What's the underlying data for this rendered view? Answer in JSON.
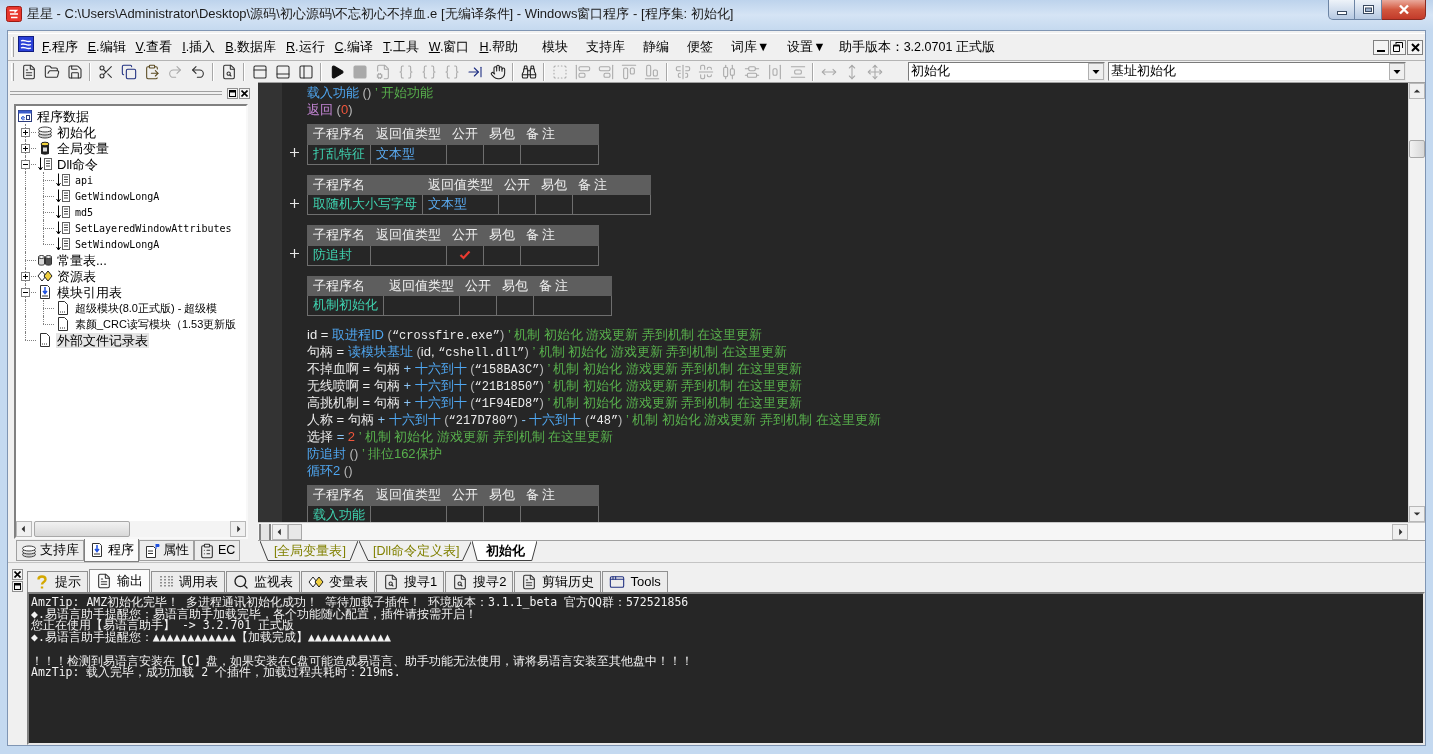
{
  "window": {
    "title": "星星 - C:\\Users\\Administrator\\Desktop\\源码\\初心源码\\不忘初心不掉血.e [无编译条件] - Windows窗口程序 - [程序集: 初始化]"
  },
  "menu": {
    "main": [
      {
        "hotkey": "F",
        "label": ".程序"
      },
      {
        "hotkey": "E",
        "label": ".编辑"
      },
      {
        "hotkey": "V",
        "label": ".查看"
      },
      {
        "hotkey": "I",
        "label": ".插入"
      },
      {
        "hotkey": "B",
        "label": ".数据库"
      },
      {
        "hotkey": "R",
        "label": ".运行"
      },
      {
        "hotkey": "C",
        "label": ".编译"
      },
      {
        "hotkey": "T",
        "label": ".工具"
      },
      {
        "hotkey": "W",
        "label": ".窗口"
      },
      {
        "hotkey": "H",
        "label": ".帮助"
      }
    ],
    "plugins": [
      {
        "label": "模块"
      },
      {
        "label": "支持库"
      },
      {
        "label": "静编"
      },
      {
        "label": "便签"
      },
      {
        "label": "词库▼"
      },
      {
        "label": "设置▼"
      }
    ],
    "version": "助手版本：3.2.0701 正式版"
  },
  "toolbar": {
    "groups": [
      [
        {
          "kind": "new",
          "disabled": false
        },
        {
          "kind": "open",
          "disabled": false
        },
        {
          "kind": "save",
          "disabled": false
        }
      ],
      [
        {
          "kind": "cut",
          "disabled": false
        },
        {
          "kind": "copy",
          "disabled": false
        },
        {
          "kind": "paste",
          "disabled": false
        },
        {
          "kind": "redo",
          "disabled": true
        },
        {
          "kind": "undo",
          "disabled": false
        }
      ],
      [
        {
          "kind": "preview",
          "disabled": false
        }
      ],
      [
        {
          "kind": "paneltop",
          "disabled": false
        },
        {
          "kind": "panelbottom",
          "disabled": false
        },
        {
          "kind": "panelleft",
          "disabled": false
        }
      ],
      [
        {
          "kind": "run",
          "disabled": false
        },
        {
          "kind": "stop",
          "disabled": true
        },
        {
          "kind": "debug",
          "disabled": true
        },
        {
          "kind": "stepinto",
          "disabled": true
        },
        {
          "kind": "stepover",
          "disabled": true
        },
        {
          "kind": "stepout",
          "disabled": true
        },
        {
          "kind": "runto",
          "disabled": false
        },
        {
          "kind": "hand",
          "disabled": false
        }
      ],
      [
        {
          "kind": "find",
          "disabled": false
        }
      ],
      [
        {
          "kind": "form",
          "disabled": true
        },
        {
          "kind": "alignleft",
          "disabled": true
        },
        {
          "kind": "alignright",
          "disabled": true
        },
        {
          "kind": "aligntop",
          "disabled": true
        },
        {
          "kind": "alignbottom",
          "disabled": true
        }
      ],
      [
        {
          "kind": "centerh",
          "disabled": true
        },
        {
          "kind": "centerv",
          "disabled": true
        },
        {
          "kind": "distributeh",
          "disabled": true
        },
        {
          "kind": "distributev",
          "disabled": true
        },
        {
          "kind": "spaceh",
          "disabled": true
        },
        {
          "kind": "spacev",
          "disabled": true
        }
      ],
      [
        {
          "kind": "samewidth",
          "disabled": true
        },
        {
          "kind": "sameheight",
          "disabled": true
        },
        {
          "kind": "samesize",
          "disabled": true
        }
      ]
    ],
    "selectors": [
      {
        "value": "初始化"
      },
      {
        "value": "基址初始化"
      }
    ]
  },
  "sidebar": {
    "tree": {
      "label": "程序数据",
      "kind": "root",
      "selected": false,
      "children": [
        {
          "label": "初始化",
          "kind": "module",
          "expanded": false,
          "selected": false
        },
        {
          "label": "全局变量",
          "kind": "variables",
          "expanded": false,
          "selected": false
        },
        {
          "label": "Dll命令",
          "kind": "dll",
          "expanded": true,
          "selected": false,
          "children": [
            {
              "label": "api",
              "kind": "dll",
              "selected": false
            },
            {
              "label": "GetWindowLongA",
              "kind": "dll",
              "selected": false
            },
            {
              "label": "md5",
              "kind": "dll",
              "selected": false
            },
            {
              "label": "SetLayeredWindowAttributes",
              "kind": "dll",
              "selected": false
            },
            {
              "label": "SetWindowLongA",
              "kind": "dll",
              "selected": false
            }
          ]
        },
        {
          "label": "常量表...",
          "kind": "constants",
          "selected": false
        },
        {
          "label": "资源表",
          "kind": "resources",
          "expanded": false,
          "selected": false
        },
        {
          "label": "模块引用表",
          "kind": "modules",
          "expanded": true,
          "selected": false,
          "children": [
            {
              "label": "超级模块(8.0正式版) - 超级模",
              "kind": "file",
              "selected": false
            },
            {
              "label": "素颜_CRC读写模块（1.53更新版",
              "kind": "file",
              "selected": false
            }
          ]
        },
        {
          "label": "外部文件记录表",
          "kind": "file",
          "selected": true
        }
      ]
    },
    "tabs": [
      {
        "label": "支持库",
        "kind": "library",
        "selected": false
      },
      {
        "label": "程序",
        "kind": "program",
        "selected": true
      },
      {
        "label": "属性",
        "kind": "properties",
        "selected": false
      },
      {
        "label": "EC",
        "kind": "ec",
        "selected": false
      }
    ]
  },
  "editor": {
    "blocks": [
      {
        "kind": "line",
        "tokens": [
          {
            "kind": "call",
            "text": "载入功能"
          },
          {
            "kind": "punct",
            "text": " () "
          },
          {
            "kind": "comment",
            "text": "’ 开始功能"
          }
        ]
      },
      {
        "kind": "line",
        "tokens": [
          {
            "kind": "keyword",
            "text": "返回"
          },
          {
            "kind": "punct",
            "text": " ("
          },
          {
            "kind": "number",
            "text": "0"
          },
          {
            "kind": "punct",
            "text": ")"
          }
        ]
      },
      {
        "kind": "table",
        "expanded": false,
        "columns": [
          "子程序名",
          "返回值类型",
          "公开",
          "易包",
          "备 注"
        ],
        "row": {
          "name": "打乱特征",
          "return_type": "文本型",
          "public": false
        }
      },
      {
        "kind": "table",
        "expanded": false,
        "columns": [
          "子程序名",
          "返回值类型",
          "公开",
          "易包",
          "备 注"
        ],
        "row": {
          "name": "取随机大小写字母",
          "return_type": "文本型",
          "public": false
        }
      },
      {
        "kind": "table",
        "expanded": false,
        "columns": [
          "子程序名",
          "返回值类型",
          "公开",
          "易包",
          "备 注"
        ],
        "row": {
          "name": "防追封",
          "public": true
        }
      },
      {
        "kind": "table",
        "expanded": true,
        "columns": [
          "子程序名",
          "返回值类型",
          "公开",
          "易包",
          "备 注"
        ],
        "row": {
          "name": "机制初始化",
          "public": false
        }
      },
      {
        "kind": "line",
        "tokens": [
          {
            "kind": "plain",
            "text": "id = "
          },
          {
            "kind": "call",
            "text": "取进程ID"
          },
          {
            "kind": "punct",
            "text": " ("
          },
          {
            "kind": "string",
            "text": "“crossfire.exe”"
          },
          {
            "kind": "punct",
            "text": ") "
          },
          {
            "kind": "comment",
            "text": "’ 机制 初始化 游戏更新 弄到机制 在这里更新"
          }
        ]
      },
      {
        "kind": "line",
        "tokens": [
          {
            "kind": "plain",
            "text": "句柄 = "
          },
          {
            "kind": "call",
            "text": "读模块基址"
          },
          {
            "kind": "punct",
            "text": " ("
          },
          {
            "kind": "plain",
            "text": "id, "
          },
          {
            "kind": "string",
            "text": "“cshell.dll”"
          },
          {
            "kind": "punct",
            "text": ") "
          },
          {
            "kind": "comment",
            "text": "’ 机制 初始化 游戏更新 弄到机制 在这里更新"
          }
        ]
      },
      {
        "kind": "line",
        "tokens": [
          {
            "kind": "plain",
            "text": "不掉血啊 = 句柄 "
          },
          {
            "kind": "op",
            "text": "+ "
          },
          {
            "kind": "call",
            "text": "十六到十"
          },
          {
            "kind": "punct",
            "text": " ("
          },
          {
            "kind": "string",
            "text": "“158BA3C”"
          },
          {
            "kind": "punct",
            "text": ") "
          },
          {
            "kind": "comment",
            "text": "’ 机制 初始化 游戏更新 弄到机制 在这里更新"
          }
        ]
      },
      {
        "kind": "line",
        "tokens": [
          {
            "kind": "plain",
            "text": "无线喷啊 = 句柄 "
          },
          {
            "kind": "op",
            "text": "+ "
          },
          {
            "kind": "call",
            "text": "十六到十"
          },
          {
            "kind": "punct",
            "text": " ("
          },
          {
            "kind": "string",
            "text": "“21B1850”"
          },
          {
            "kind": "punct",
            "text": ") "
          },
          {
            "kind": "comment",
            "text": "’ 机制 初始化 游戏更新 弄到机制 在这里更新"
          }
        ]
      },
      {
        "kind": "line",
        "tokens": [
          {
            "kind": "plain",
            "text": "高挑机制 = 句柄 "
          },
          {
            "kind": "op",
            "text": "+ "
          },
          {
            "kind": "call",
            "text": "十六到十"
          },
          {
            "kind": "punct",
            "text": " ("
          },
          {
            "kind": "string",
            "text": "“1F94ED8”"
          },
          {
            "kind": "punct",
            "text": ") "
          },
          {
            "kind": "comment",
            "text": "’ 机制 初始化 游戏更新 弄到机制 在这里更新"
          }
        ]
      },
      {
        "kind": "line",
        "tokens": [
          {
            "kind": "plain",
            "text": "人称 = 句柄 "
          },
          {
            "kind": "op",
            "text": "+ "
          },
          {
            "kind": "call",
            "text": "十六到十"
          },
          {
            "kind": "punct",
            "text": " ("
          },
          {
            "kind": "string",
            "text": "“217D780”"
          },
          {
            "kind": "punct",
            "text": ") "
          },
          {
            "kind": "op",
            "text": "- "
          },
          {
            "kind": "call",
            "text": "十六到十"
          },
          {
            "kind": "punct",
            "text": " ("
          },
          {
            "kind": "string",
            "text": "“48”"
          },
          {
            "kind": "punct",
            "text": ") "
          },
          {
            "kind": "comment",
            "text": "’ 机制 初始化 游戏更新 弄到机制 在这里更新"
          }
        ]
      },
      {
        "kind": "line",
        "tokens": [
          {
            "kind": "plain",
            "text": "选择 "
          },
          {
            "kind": "op",
            "text": "= "
          },
          {
            "kind": "number",
            "text": "2"
          },
          {
            "kind": "comment",
            "text": " ’ 机制 初始化 游戏更新 弄到机制 在这里更新"
          }
        ]
      },
      {
        "kind": "line",
        "tokens": [
          {
            "kind": "call",
            "text": "防追封"
          },
          {
            "kind": "punct",
            "text": " () "
          },
          {
            "kind": "comment",
            "text": "’ 排位162保护"
          }
        ]
      },
      {
        "kind": "line",
        "tokens": [
          {
            "kind": "call",
            "text": "循环2"
          },
          {
            "kind": "punct",
            "text": " ()"
          }
        ]
      },
      {
        "kind": "table",
        "expanded": true,
        "columns": [
          "子程序名",
          "返回值类型",
          "公开",
          "易包",
          "备 注"
        ],
        "row": {
          "name": "载入功能",
          "public": false
        }
      }
    ],
    "tabs": [
      {
        "label": "[全局变量表]",
        "selected": false
      },
      {
        "label": "[Dll命令定义表]",
        "selected": false
      },
      {
        "label": "初始化",
        "selected": true
      }
    ]
  },
  "output_panel": {
    "tabs": [
      {
        "label": "提示",
        "kind": "tip",
        "selected": false
      },
      {
        "label": "输出",
        "kind": "output",
        "selected": true
      },
      {
        "label": "调用表",
        "kind": "calls",
        "selected": false
      },
      {
        "label": "监视表",
        "kind": "watch",
        "selected": false
      },
      {
        "label": "变量表",
        "kind": "variables",
        "selected": false
      },
      {
        "label": "搜寻1",
        "kind": "search",
        "selected": false
      },
      {
        "label": "搜寻2",
        "kind": "search",
        "selected": false
      },
      {
        "label": "剪辑历史",
        "kind": "history",
        "selected": false
      },
      {
        "label": "Tools",
        "kind": "tools",
        "selected": false
      }
    ],
    "blocks": [
      [
        "AmzTip: AMZ初始化完毕！ 多进程通讯初始化成功！ 等待加载子插件！ 环境版本：3.1.1_beta 官方QQ群：572521856",
        "◆.易语言助手提醒您：易语言助手加载完毕，各个功能随心配置，插件请按需开启！",
        "您正在使用【易语言助手】 -> 3.2.701 正式版",
        "◆.易语言助手提醒您：▲▲▲▲▲▲▲▲▲▲▲▲【加载完成】▲▲▲▲▲▲▲▲▲▲▲▲"
      ],
      [
        "！！！检测到易语言安装在【C】盘，如果安装在C盘可能造成易语言、助手功能无法使用，请将易语言安装至其他盘中！！！",
        "AmzTip: 载入完毕，成功加载 2 个插件，加载过程共耗时：219ms."
      ]
    ]
  }
}
